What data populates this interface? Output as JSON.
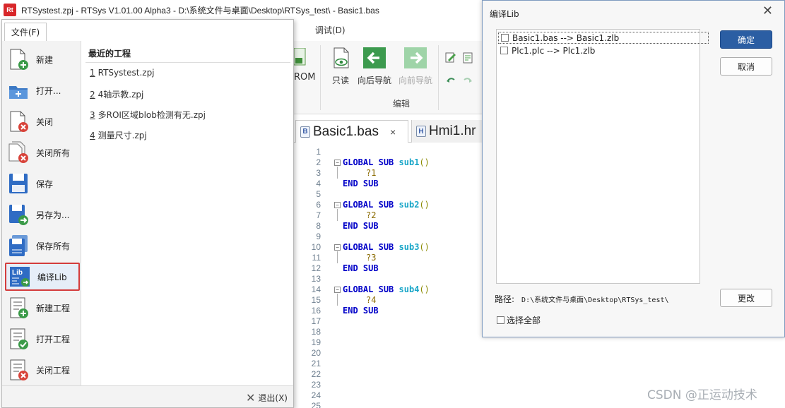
{
  "window": {
    "app_icon": "Rt",
    "title": "RTSystest.zpj - RTSys V1.01.00 Alpha3 - D:\\系统文件与桌面\\Desktop\\RTSys_test\\ - Basic1.bas"
  },
  "ribbon": {
    "tab_debug": "调试(D)",
    "rom_label": "ROM",
    "buttons": [
      {
        "label": "只读",
        "icon": "read-only-icon"
      },
      {
        "label": "向后导航",
        "icon": "navigate-back-icon"
      },
      {
        "label": "向前导航",
        "icon": "navigate-forward-icon"
      }
    ],
    "group_label": "编辑"
  },
  "editor": {
    "tabs": [
      {
        "label": "Basic1.bas",
        "close": "×"
      },
      {
        "label": "Hmi1.hr"
      }
    ],
    "line_numbers": [
      "1",
      "2",
      "3",
      "4",
      "5",
      "6",
      "7",
      "8",
      "9",
      "10",
      "11",
      "12",
      "13",
      "14",
      "15",
      "16",
      "17",
      "18",
      "19",
      "20",
      "21",
      "22",
      "23",
      "24",
      "25"
    ],
    "code": {
      "global": "GLOBAL",
      "sub": "SUB",
      "end": "END",
      "blocks": [
        {
          "name": "sub1",
          "parens": "()",
          "body": "?1"
        },
        {
          "name": "sub2",
          "parens": "()",
          "body": "?2"
        },
        {
          "name": "sub3",
          "parens": "()",
          "body": "?3"
        },
        {
          "name": "sub4",
          "parens": "()",
          "body": "?4"
        }
      ]
    }
  },
  "file_menu": {
    "tab_label": "文件(F)",
    "items": [
      {
        "label": "新建",
        "icon": "new-file-icon"
      },
      {
        "label": "打开...",
        "icon": "open-folder-icon"
      },
      {
        "label": "关闭",
        "icon": "close-file-icon"
      },
      {
        "label": "关闭所有",
        "icon": "close-all-icon"
      },
      {
        "label": "保存",
        "icon": "save-icon"
      },
      {
        "label": "另存为...",
        "icon": "save-as-icon"
      },
      {
        "label": "保存所有",
        "icon": "save-all-icon"
      },
      {
        "label": "编译Lib",
        "icon": "compile-lib-icon"
      },
      {
        "label": "新建工程",
        "icon": "new-project-icon"
      },
      {
        "label": "打开工程",
        "icon": "open-project-icon"
      },
      {
        "label": "关闭工程",
        "icon": "close-project-icon"
      }
    ],
    "recent_title": "最近的工程",
    "recent": [
      {
        "num": "1",
        "name": "RTSystest.zpj"
      },
      {
        "num": "2",
        "name": "4轴示教.zpj"
      },
      {
        "num": "3",
        "name": "多ROI区域blob检测有无.zpj"
      },
      {
        "num": "4",
        "name": "测量尺寸.zpj"
      }
    ],
    "exit_label": "退出(X)"
  },
  "dialog": {
    "title": "编译Lib",
    "close": "✕",
    "list": [
      "Basic1.bas --> Basic1.zlb",
      "Plc1.plc --> Plc1.zlb"
    ],
    "ok_label": "确定",
    "cancel_label": "取消",
    "path_label": "路径:",
    "path_value": "D:\\系统文件与桌面\\Desktop\\RTSys_test\\",
    "change_label": "更改",
    "select_all_label": "选择全部"
  },
  "watermark": "CSDN @正运动技术",
  "colors": {
    "highlight_border": "#d43c3c",
    "primary_button": "#2b5ea3",
    "keyword": "#0000c8",
    "function_name": "#19a6c8"
  }
}
